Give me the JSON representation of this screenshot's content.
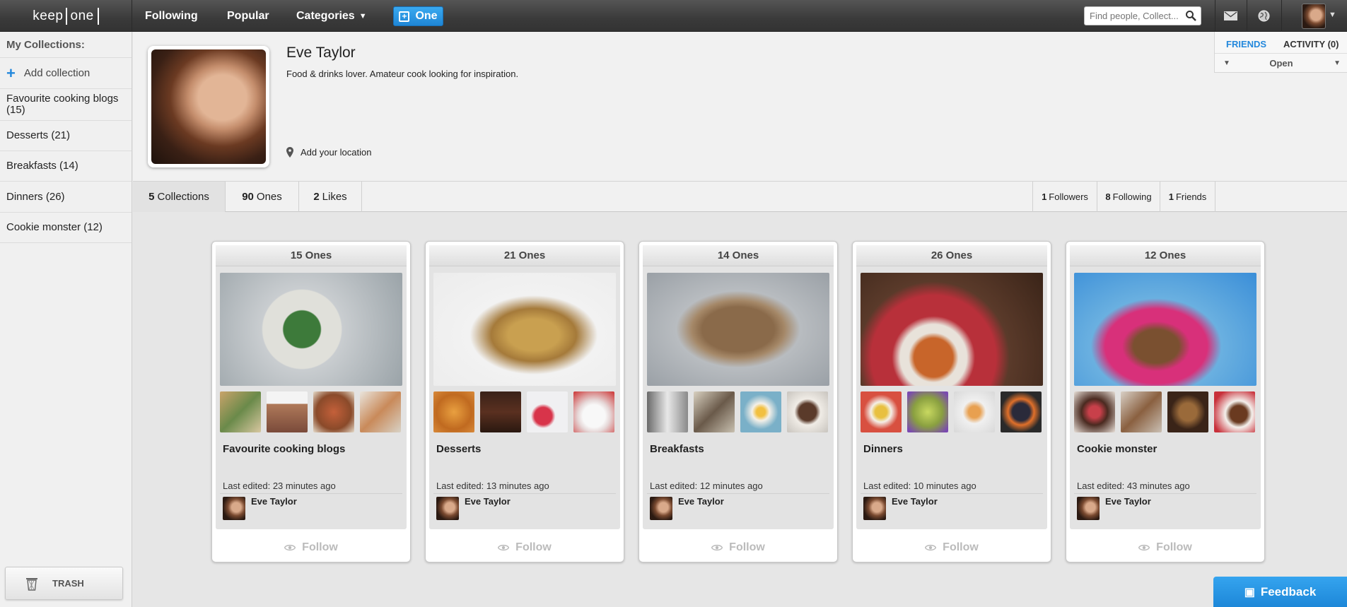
{
  "brand": {
    "logo_left": "keep",
    "logo_right": "one"
  },
  "topnav": {
    "following": "Following",
    "popular": "Popular",
    "categories": "Categories",
    "one_button": "One",
    "search_placeholder": "Find people, Collect..."
  },
  "sidebar": {
    "title": "My Collections:",
    "add_label": "Add collection",
    "items": [
      {
        "label": "Favourite cooking blogs (15)"
      },
      {
        "label": "Desserts (21)"
      },
      {
        "label": "Breakfasts (14)"
      },
      {
        "label": "Dinners (26)"
      },
      {
        "label": "Cookie monster (12)"
      }
    ],
    "trash_label": "TRASH"
  },
  "profile": {
    "name": "Eve Taylor",
    "bio": "Food & drinks lover. Amateur cook looking for inspiration.",
    "location_prompt": "Add your location"
  },
  "friends_panel": {
    "friends_tab": "FRIENDS",
    "activity_tab": "ACTIVITY (0)",
    "open_label": "Open"
  },
  "stats": [
    {
      "count": "5",
      "label": "Collections"
    },
    {
      "count": "90",
      "label": "Ones"
    },
    {
      "count": "2",
      "label": "Likes"
    }
  ],
  "social": [
    {
      "count": "1",
      "label": "Followers"
    },
    {
      "count": "8",
      "label": "Following"
    },
    {
      "count": "1",
      "label": "Friends"
    }
  ],
  "cards": [
    {
      "count_label": "15 Ones",
      "title": "Favourite cooking blogs",
      "edited": "Last edited: 23 minutes ago",
      "author": "Eve Taylor",
      "follow": "Follow"
    },
    {
      "count_label": "21 Ones",
      "title": "Desserts",
      "edited": "Last edited: 13 minutes ago",
      "author": "Eve Taylor",
      "follow": "Follow"
    },
    {
      "count_label": "14 Ones",
      "title": "Breakfasts",
      "edited": "Last edited: 12 minutes ago",
      "author": "Eve Taylor",
      "follow": "Follow"
    },
    {
      "count_label": "26 Ones",
      "title": "Dinners",
      "edited": "Last edited: 10 minutes ago",
      "author": "Eve Taylor",
      "follow": "Follow"
    },
    {
      "count_label": "12 Ones",
      "title": "Cookie monster",
      "edited": "Last edited: 43 minutes ago",
      "author": "Eve Taylor",
      "follow": "Follow"
    }
  ],
  "feedback_label": "Feedback",
  "colors": {
    "accent": "#2388dc",
    "topbar": "#3a3a3a"
  }
}
